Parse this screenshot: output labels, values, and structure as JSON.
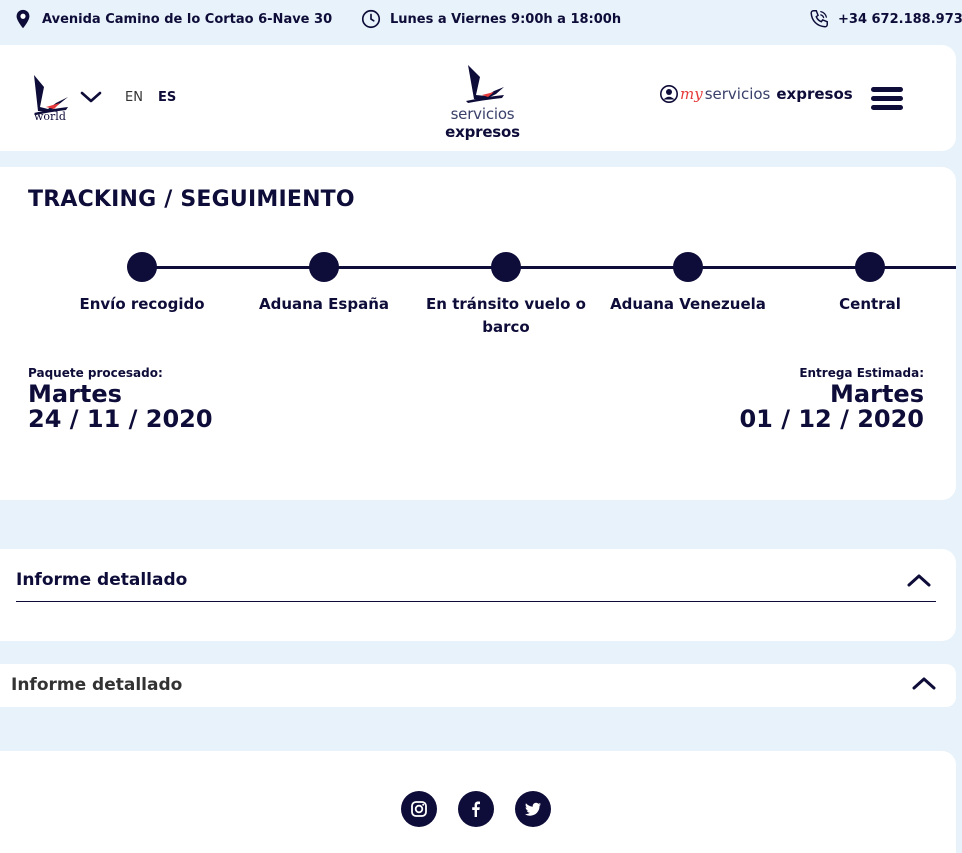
{
  "topbar": {
    "address": "Avenida Camino de lo Cortao 6-Nave 30",
    "hours": "Lunes a Viernes 9:00h a 18:00h",
    "phone": "+34 672.188.973"
  },
  "header": {
    "world_label": "world",
    "lang_en": "EN",
    "lang_es": "ES",
    "brand_light": "servicios ",
    "brand_bold": "expresos",
    "my_prefix": "my",
    "my_light": "servicios",
    "my_bold": "expresos"
  },
  "tracking": {
    "title": "TRACKING / SEGUIMIENTO",
    "steps": [
      {
        "label": "Envío recogido"
      },
      {
        "label": "Aduana España"
      },
      {
        "label": "En tránsito vuelo o barco"
      },
      {
        "label": "Aduana Venezuela"
      },
      {
        "label": "Central"
      }
    ],
    "processed_label": "Paquete procesado:",
    "processed_day": "Martes",
    "processed_date": "24 / 11 / 2020",
    "estimated_label": "Entrega Estimada:",
    "estimated_day": "Martes",
    "estimated_date": "01 / 12 / 2020"
  },
  "reports": [
    {
      "title": "Informe detallado"
    },
    {
      "title": "Informe detallado"
    }
  ],
  "icons": {
    "location": "location-pin-icon",
    "clock": "clock-icon",
    "phone": "phone-icon",
    "chevron": "chevron-down-icon",
    "caret": "chevron-up-icon",
    "user": "user-icon",
    "menu": "hamburger-menu-icon",
    "social": [
      "instagram-icon",
      "facebook-icon",
      "twitter-icon"
    ]
  },
  "colors": {
    "navy": "#0e0c38",
    "background": "#e8f2fa",
    "accent_red": "#e63a3a"
  }
}
